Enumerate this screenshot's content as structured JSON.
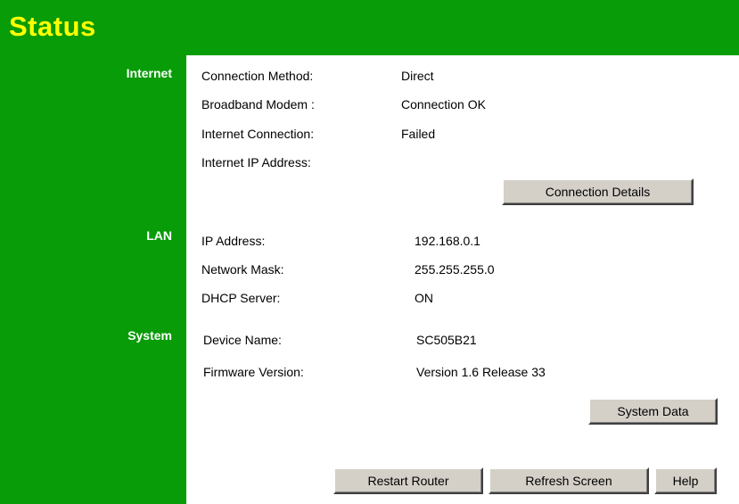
{
  "header": {
    "title": "Status"
  },
  "sections": {
    "internet": "Internet",
    "lan": "LAN",
    "system": "System"
  },
  "internet": {
    "connection_method_label": "Connection Method:",
    "connection_method_value": "Direct",
    "broadband_modem_label": "Broadband Modem :",
    "broadband_modem_value": "Connection OK",
    "internet_connection_label": "Internet Connection:",
    "internet_connection_value": "Failed",
    "internet_ip_label": "Internet IP Address:",
    "internet_ip_value": "",
    "details_button": "Connection Details"
  },
  "lan": {
    "ip_label": "IP Address:",
    "ip_value": "192.168.0.1",
    "mask_label": "Network Mask:",
    "mask_value": "255.255.255.0",
    "dhcp_label": "DHCP Server:",
    "dhcp_value": "ON"
  },
  "system": {
    "device_name_label": "Device Name:",
    "device_name_value": "SC505B21",
    "firmware_label": "Firmware Version:",
    "firmware_value": "Version 1.6 Release 33",
    "system_data_button": "System Data"
  },
  "footer": {
    "restart_button": "Restart Router",
    "refresh_button": "Refresh Screen",
    "help_button": "Help"
  },
  "colors": {
    "header_green": "#089c08",
    "title_yellow": "#ffff00",
    "button_face": "#d4d0c8"
  }
}
